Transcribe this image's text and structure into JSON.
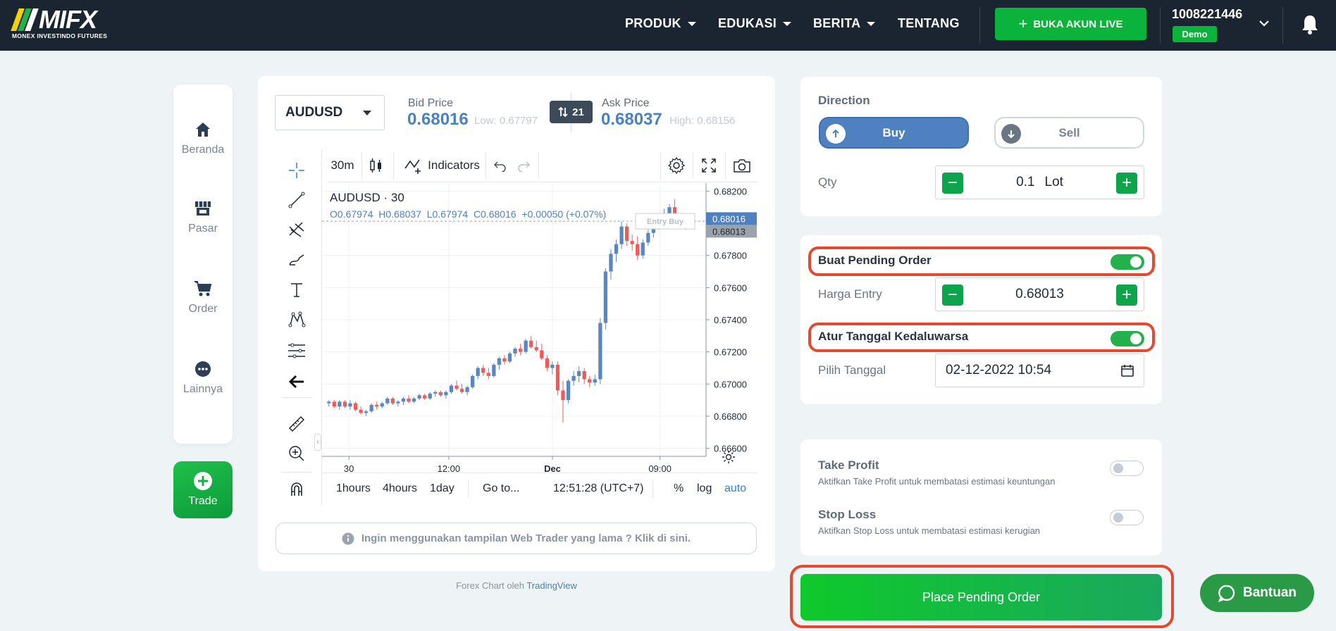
{
  "nav": {
    "brand": "MIFX",
    "brand_sub": "MONEX INVESTINDO FUTURES",
    "menu": [
      "PRODUK",
      "EDUKASI",
      "BERITA",
      "TENTANG"
    ],
    "live_button": "BUKA AKUN LIVE",
    "account_number": "1008221446",
    "account_type": "Demo"
  },
  "sidebar": {
    "items": [
      {
        "label": "Beranda",
        "icon": "home-icon"
      },
      {
        "label": "Pasar",
        "icon": "store-icon"
      },
      {
        "label": "Order",
        "icon": "cart-icon"
      },
      {
        "label": "Lainnya",
        "icon": "more-icon"
      }
    ],
    "trade_label": "Trade"
  },
  "quote": {
    "symbol": "AUDUSD",
    "bid_label": "Bid Price",
    "bid": "0.68016",
    "low": "Low: 0.67797",
    "spread": "21",
    "ask_label": "Ask Price",
    "ask": "0.68037",
    "high": "High: 0.68156"
  },
  "chart_toolbar": {
    "interval": "30m",
    "indicators": "Indicators"
  },
  "chart_header": {
    "title": "AUDUSD · 30",
    "ohlc": "O0.67974  H0.68037  L0.67974  C0.68016  +0.00050 (+0.07%)",
    "entry_tag": "Entry Buy",
    "last_price_tag": "0.68016",
    "entry_price_tag": "0.68013"
  },
  "chart_data": {
    "type": "candlestick",
    "symbol": "AUDUSD",
    "interval": "30",
    "y_ticks": [
      "0.68200",
      "0.67800",
      "0.67600",
      "0.67400",
      "0.67200",
      "0.67000",
      "0.66800",
      "0.66600"
    ],
    "x_ticks": [
      "30",
      "12:00",
      "Dec",
      "09:00"
    ],
    "ylim": [
      0.6655,
      0.6825
    ],
    "entry_line": 0.68013,
    "last_price": 0.68016,
    "candles": [
      [
        0.6688,
        0.669,
        0.6686,
        0.6689
      ],
      [
        0.6689,
        0.669,
        0.6685,
        0.6686
      ],
      [
        0.6686,
        0.669,
        0.6684,
        0.6689
      ],
      [
        0.6689,
        0.669,
        0.6685,
        0.6686
      ],
      [
        0.6686,
        0.669,
        0.6684,
        0.6688
      ],
      [
        0.6688,
        0.6689,
        0.6683,
        0.6684
      ],
      [
        0.6684,
        0.6686,
        0.6681,
        0.6682
      ],
      [
        0.6682,
        0.6684,
        0.668,
        0.6683
      ],
      [
        0.6683,
        0.6688,
        0.6682,
        0.6687
      ],
      [
        0.6687,
        0.6689,
        0.6684,
        0.6686
      ],
      [
        0.6686,
        0.6689,
        0.6685,
        0.6688
      ],
      [
        0.6688,
        0.6692,
        0.6687,
        0.6691
      ],
      [
        0.6691,
        0.6692,
        0.6687,
        0.6688
      ],
      [
        0.6688,
        0.669,
        0.6686,
        0.6689
      ],
      [
        0.6689,
        0.6692,
        0.6687,
        0.6691
      ],
      [
        0.6691,
        0.6693,
        0.6688,
        0.6689
      ],
      [
        0.6689,
        0.6692,
        0.6688,
        0.6691
      ],
      [
        0.6691,
        0.6694,
        0.669,
        0.6693
      ],
      [
        0.6693,
        0.6694,
        0.669,
        0.6691
      ],
      [
        0.6691,
        0.6695,
        0.669,
        0.6694
      ],
      [
        0.6694,
        0.6696,
        0.6692,
        0.6695
      ],
      [
        0.6695,
        0.6696,
        0.6692,
        0.6693
      ],
      [
        0.6693,
        0.6696,
        0.6691,
        0.6695
      ],
      [
        0.6695,
        0.67,
        0.6694,
        0.6699
      ],
      [
        0.6699,
        0.6702,
        0.6696,
        0.6697
      ],
      [
        0.6697,
        0.67,
        0.6694,
        0.6695
      ],
      [
        0.6695,
        0.6699,
        0.6693,
        0.6698
      ],
      [
        0.6698,
        0.6706,
        0.6697,
        0.6705
      ],
      [
        0.6705,
        0.6711,
        0.6703,
        0.671
      ],
      [
        0.671,
        0.6712,
        0.6705,
        0.6707
      ],
      [
        0.6707,
        0.671,
        0.6703,
        0.6705
      ],
      [
        0.6705,
        0.6713,
        0.6704,
        0.6712
      ],
      [
        0.6712,
        0.6717,
        0.6709,
        0.6716
      ],
      [
        0.6716,
        0.6718,
        0.6712,
        0.6714
      ],
      [
        0.6714,
        0.672,
        0.6713,
        0.6719
      ],
      [
        0.6719,
        0.6723,
        0.6717,
        0.6722
      ],
      [
        0.6722,
        0.6725,
        0.6718,
        0.672
      ],
      [
        0.672,
        0.6728,
        0.6719,
        0.6727
      ],
      [
        0.6727,
        0.673,
        0.6722,
        0.6723
      ],
      [
        0.6723,
        0.6727,
        0.672,
        0.6721
      ],
      [
        0.6721,
        0.6725,
        0.6715,
        0.6716
      ],
      [
        0.6716,
        0.6718,
        0.6708,
        0.671
      ],
      [
        0.671,
        0.6714,
        0.6706,
        0.6712
      ],
      [
        0.6712,
        0.6714,
        0.6693,
        0.6696
      ],
      [
        0.6696,
        0.6702,
        0.6676,
        0.669
      ],
      [
        0.669,
        0.6703,
        0.6688,
        0.6702
      ],
      [
        0.6702,
        0.6708,
        0.6699,
        0.6705
      ],
      [
        0.6705,
        0.6711,
        0.6701,
        0.6708
      ],
      [
        0.6708,
        0.671,
        0.67,
        0.6703
      ],
      [
        0.6703,
        0.6705,
        0.6698,
        0.6701
      ],
      [
        0.6701,
        0.6706,
        0.6699,
        0.6703
      ],
      [
        0.6703,
        0.6741,
        0.67,
        0.6738
      ],
      [
        0.6738,
        0.6772,
        0.6734,
        0.677
      ],
      [
        0.677,
        0.6784,
        0.6765,
        0.6781
      ],
      [
        0.6781,
        0.679,
        0.6776,
        0.6787
      ],
      [
        0.6787,
        0.6801,
        0.6784,
        0.6798
      ],
      [
        0.6798,
        0.68,
        0.6786,
        0.6789
      ],
      [
        0.6789,
        0.6793,
        0.6783,
        0.6787
      ],
      [
        0.6787,
        0.6792,
        0.6777,
        0.678
      ],
      [
        0.678,
        0.679,
        0.6778,
        0.6788
      ],
      [
        0.6788,
        0.6796,
        0.6786,
        0.6794
      ],
      [
        0.6794,
        0.6801,
        0.6791,
        0.6798
      ],
      [
        0.6798,
        0.6806,
        0.6796,
        0.6804
      ],
      [
        0.6804,
        0.6809,
        0.6799,
        0.6806
      ],
      [
        0.6806,
        0.6812,
        0.6802,
        0.681
      ],
      [
        0.681,
        0.6815,
        0.6801,
        0.6804
      ],
      [
        0.6804,
        0.6806,
        0.6797,
        0.6799
      ],
      [
        0.6799,
        0.6803,
        0.6796,
        0.6801
      ],
      [
        0.6797,
        0.6804,
        0.6797,
        0.6802
      ]
    ]
  },
  "chart_bottom": {
    "ranges": [
      "1hours",
      "4hours",
      "1day"
    ],
    "goto": "Go to...",
    "time": "12:51:28 (UTC+7)",
    "percent": "%",
    "log": "log",
    "auto": "auto"
  },
  "legacy_notice": "Ingin menggunakan tampilan Web Trader yang lama ? Klik di sini.",
  "credit": {
    "text": "Forex Chart oleh",
    "link": "TradingView"
  },
  "order": {
    "direction_label": "Direction",
    "buy": "Buy",
    "sell": "Sell",
    "qty_label": "Qty",
    "qty_value": "0.1",
    "qty_unit": "Lot",
    "pending_label": "Buat Pending Order",
    "pending_on": true,
    "entry_label": "Harga Entry",
    "entry_value": "0.68013",
    "expiry_label": "Atur Tanggal Kedaluwarsa",
    "expiry_on": true,
    "date_label": "Pilih Tanggal",
    "date_value": "02-12-2022 10:54",
    "tp_label": "Take Profit",
    "tp_desc": "Aktifkan Take Profit untuk membatasi estimasi keuntungan",
    "tp_on": false,
    "sl_label": "Stop Loss",
    "sl_desc": "Aktifkan Stop Loss untuk membatasi estimasi kerugian",
    "sl_on": false,
    "submit": "Place Pending Order"
  },
  "help_label": "Bantuan",
  "colors": {
    "green": "#0ab43a",
    "blue": "#4f80c0",
    "up": "#5b87c0",
    "down": "#ef5b5b",
    "highlight": "#e24a32",
    "nav": "#1b2431"
  }
}
